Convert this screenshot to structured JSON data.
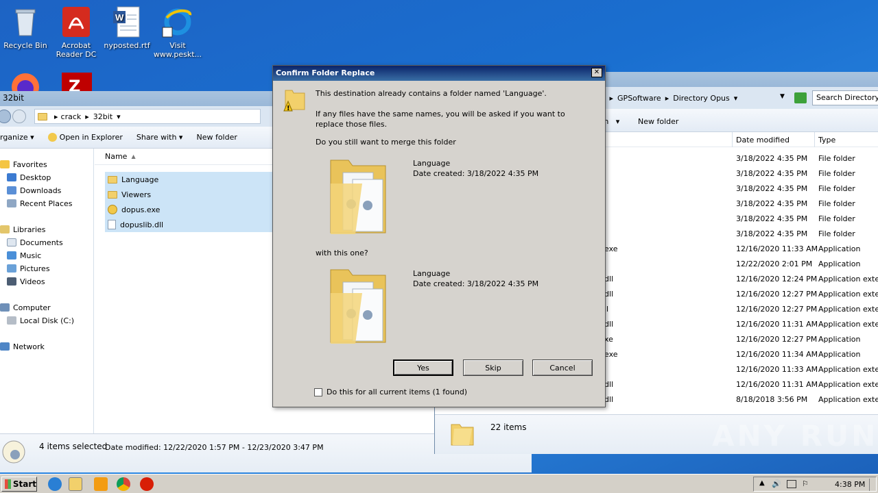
{
  "desktop": {
    "icons": [
      {
        "label": "Recycle Bin"
      },
      {
        "label": "Acrobat\nReader DC"
      },
      {
        "label": "nyposted.rtf"
      },
      {
        "label": "Visit\nwww.peskt..."
      }
    ]
  },
  "left_window": {
    "title": "32bit",
    "breadcrumb": [
      "crack",
      "32bit"
    ],
    "toolbar": {
      "organize": "rganize",
      "open_in_explorer": "Open in Explorer",
      "share_with": "Share with",
      "new_folder": "New folder"
    },
    "nav": {
      "favorites": "Favorites",
      "desktop": "Desktop",
      "downloads": "Downloads",
      "recent_places": "Recent Places",
      "libraries": "Libraries",
      "documents": "Documents",
      "music": "Music",
      "pictures": "Pictures",
      "videos": "Videos",
      "computer": "Computer",
      "local_disk": "Local Disk (C:)",
      "network": "Network"
    },
    "column_name": "Name",
    "files": [
      "Language",
      "Viewers",
      "dopus.exe",
      "dopuslib.dll"
    ],
    "status": {
      "selected": "4 items selected",
      "date_modified": "Date modified:  12/22/2020 1:57 PM - 12/23/2020 3:47 PM"
    }
  },
  "right_window": {
    "breadcrumb": [
      "es",
      "GPSoftware",
      "Directory Opus"
    ],
    "search_placeholder": "Search Directory O",
    "toolbar": {
      "share_with": "th",
      "new_folder": "New folder"
    },
    "columns": {
      "date_modified": "Date modified",
      "type": "Type"
    },
    "rows": [
      {
        "name": "",
        "date": "3/18/2022 4:35 PM",
        "type": "File folder"
      },
      {
        "name": "",
        "date": "3/18/2022 4:35 PM",
        "type": "File folder"
      },
      {
        "name": "",
        "date": "3/18/2022 4:35 PM",
        "type": "File folder"
      },
      {
        "name": "",
        "date": "3/18/2022 4:35 PM",
        "type": "File folder"
      },
      {
        "name": "",
        "date": "3/18/2022 4:35 PM",
        "type": "File folder"
      },
      {
        "name": "",
        "date": "3/18/2022 4:35 PM",
        "type": "File folder"
      },
      {
        "name": "exe",
        "date": "12/16/2020 11:33 AM",
        "type": "Application"
      },
      {
        "name": "",
        "date": "12/22/2020 2:01 PM",
        "type": "Application"
      },
      {
        "name": "dll",
        "date": "12/16/2020 12:24 PM",
        "type": "Application extens"
      },
      {
        "name": "dll",
        "date": "12/16/2020 12:27 PM",
        "type": "Application extens"
      },
      {
        "name": "ll",
        "date": "12/16/2020 12:27 PM",
        "type": "Application extens"
      },
      {
        "name": "dll",
        "date": "12/16/2020 11:31 AM",
        "type": "Application extens"
      },
      {
        "name": "xe",
        "date": "12/16/2020 12:27 PM",
        "type": "Application"
      },
      {
        "name": "exe",
        "date": "12/16/2020 11:34 AM",
        "type": "Application"
      },
      {
        "name": "",
        "date": "12/16/2020 11:33 AM",
        "type": "Application extens"
      },
      {
        "name": "dll",
        "date": "12/16/2020 11:31 AM",
        "type": "Application extens"
      },
      {
        "name": "dll",
        "date": "8/18/2018 3:56 PM",
        "type": "Application extens"
      }
    ],
    "status": "22 items"
  },
  "dialog": {
    "title": "Confirm Folder Replace",
    "line1": "This destination already contains a folder named 'Language'.",
    "line2": "If any files have the same names, you will be asked if you want to replace those files.",
    "line3": "Do you still want to merge this folder",
    "folder1": {
      "name": "Language",
      "created": "Date created: 3/18/2022 4:35 PM"
    },
    "with_text": "with this one?",
    "folder2": {
      "name": "Language",
      "created": "Date created: 3/18/2022 4:35 PM"
    },
    "yes": "Yes",
    "skip": "Skip",
    "cancel": "Cancel",
    "checkbox_label": "Do this for all current items (1 found)"
  },
  "taskbar": {
    "start": "Start",
    "time": "4:38 PM"
  },
  "watermark": "ANY RUN"
}
